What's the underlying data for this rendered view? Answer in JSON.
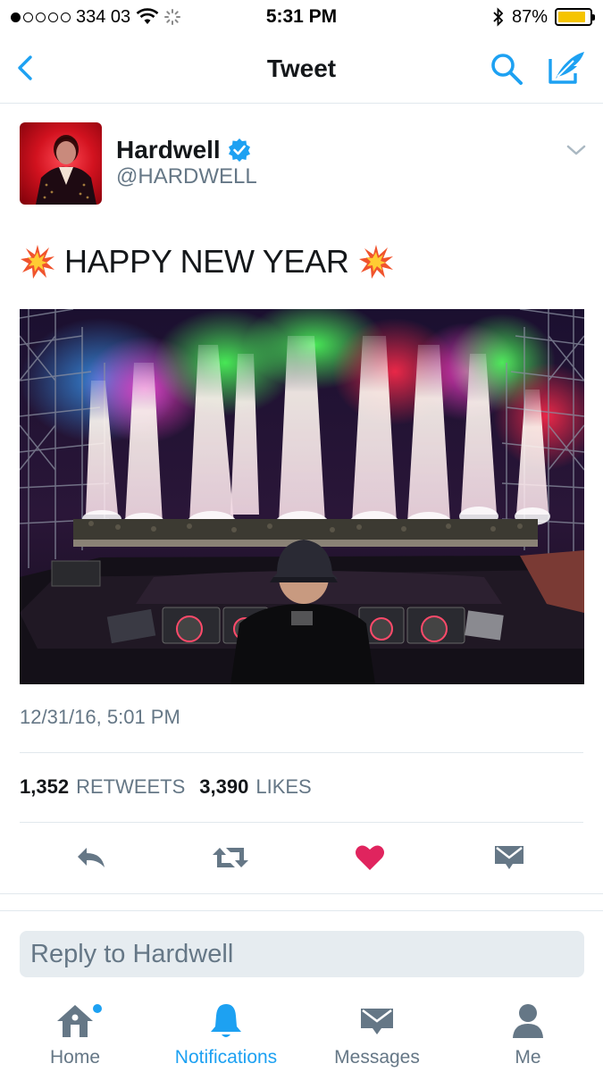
{
  "status_bar": {
    "carrier": "334 03",
    "time": "5:31 PM",
    "battery_percent": "87%",
    "battery_level": 0.87
  },
  "nav": {
    "title": "Tweet",
    "icons": [
      "back-chevron-icon",
      "search-icon",
      "compose-icon"
    ]
  },
  "tweet": {
    "author": {
      "name": "Hardwell",
      "handle": "@HARDWELL",
      "verified": true
    },
    "text": "HAPPY NEW YEAR",
    "emoji": "collision-emoji",
    "timestamp": "12/31/16, 5:01 PM",
    "retweets": "1,352",
    "retweets_label": "RETWEETS",
    "likes": "3,390",
    "likes_label": "LIKES",
    "liked": true
  },
  "actions": [
    "reply-icon",
    "retweet-icon",
    "like-heart-icon",
    "direct-message-icon"
  ],
  "reply": {
    "placeholder": "Reply to Hardwell"
  },
  "tab_bar": {
    "tabs": [
      {
        "label": "Home",
        "icon": "home-icon",
        "has_dot": true
      },
      {
        "label": "Notifications",
        "icon": "bell-icon",
        "active": true
      },
      {
        "label": "Messages",
        "icon": "envelope-icon"
      },
      {
        "label": "Me",
        "icon": "person-icon"
      }
    ]
  },
  "colors": {
    "accent": "#1da1f2",
    "like": "#e0245e",
    "muted": "#657786",
    "text": "#14171a"
  }
}
